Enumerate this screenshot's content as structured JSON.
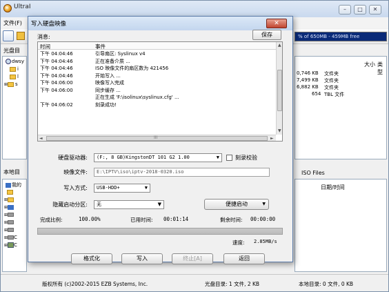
{
  "main": {
    "title": "UltraISO - E:\\IPTV\\iso\\iptv-2018-0320.iso",
    "title_visible": "UltraI",
    "menu_file": "文件(F)",
    "capacity": "% of 650MB - 459MB free",
    "cd_dir_label": "光盘目",
    "cd_tree": [
      "dwsy",
      "i",
      "l",
      "s"
    ],
    "file_list_headers": {
      "size": "大小",
      "type": "类型"
    },
    "file_list_rows": [
      {
        "size": "0,746 KB",
        "type": "文件夹"
      },
      {
        "size": "7,499 KB",
        "type": "文件夹"
      },
      {
        "size": "6,882 KB",
        "type": "文件夹"
      },
      {
        "size": "654",
        "type": "TBL 文件"
      }
    ],
    "local_dir_label": "本地目",
    "local_tree": [
      "我的",
      "",
      "",
      "",
      "",
      "",
      "",
      "C",
      "C"
    ],
    "iso_files_label": "ISO Files",
    "local_date_header": "日期/时间",
    "status": {
      "copyright": "版权所有 (c)2002-2015 EZB Systems, Inc.",
      "cd_dir": "光盘目录: 1 文件, 2 KB",
      "local_dir": "本地目录: 0 文件, 0 KB"
    }
  },
  "dialog": {
    "title": "写入硬盘映像",
    "messages_label": "消息:",
    "save_label": "保存",
    "log_headers": {
      "time": "时间",
      "event": "事件"
    },
    "log": [
      {
        "time": "下午 04:04:46",
        "event": "引导扇区: Syslinux v4"
      },
      {
        "time": "下午 04:04:46",
        "event": "正在准备介质 ..."
      },
      {
        "time": "下午 04:04:46",
        "event": "ISO 映像文件的扇区数为 421456"
      },
      {
        "time": "下午 04:04:46",
        "event": "开始写入 ..."
      },
      {
        "time": "下午 04:06:00",
        "event": "映像写入完成"
      },
      {
        "time": "下午 04:06:00",
        "event": "同步缓存 ..."
      },
      {
        "time": "",
        "event": "正在生成 'F:\\isolinux\\syslinux.cfg' ..."
      },
      {
        "time": "下午 04:06:02",
        "event": "刻录成功!"
      }
    ],
    "hscroll_mark": "III",
    "drive_label": "硬盘驱动器:",
    "drive_value": "(F:, 8 GB)KingstonDT 101 G2        1.00",
    "verify_label": "刻录校验",
    "image_label": "映像文件:",
    "image_value": "E:\\IPTV\\iso\\iptv-2018-0320.iso",
    "write_mode_label": "写入方式:",
    "write_mode_value": "USB-HDD+",
    "hidden_partition_label": "隐藏启动分区:",
    "hidden_partition_value": "无",
    "quick_boot_label": "便捷启动",
    "completion_label": "完成比例:",
    "completion_value": "100.00%",
    "progress_fraction": 1.0,
    "elapsed_label": "已用时间:",
    "elapsed_value": "00:01:14",
    "remaining_label": "剩余时间:",
    "remaining_value": "00:00:00",
    "speed_label": "速度:",
    "speed_value": "2.85MB/s",
    "format_label": "格式化",
    "write_label": "写入",
    "stop_label": "终止[A]",
    "back_label": "返回"
  },
  "colors": {
    "capacity_bar": "#0a2a78",
    "close_button": "#c04530",
    "titlebar": "#c9d9ee"
  }
}
